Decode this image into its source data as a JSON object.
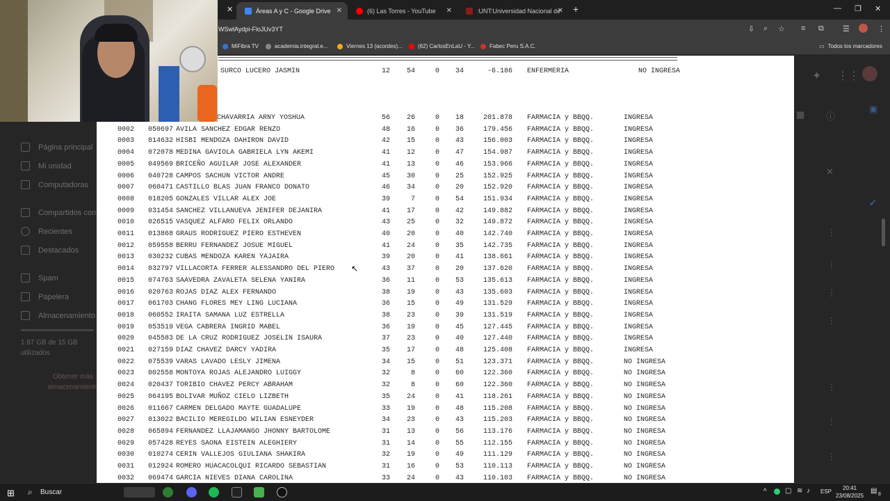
{
  "browser": {
    "tabs": [
      {
        "title": "Áreas A y C - Google Drive",
        "favicon_color": "#4285f4"
      },
      {
        "title": "(6) Las Torres - YouTube",
        "favicon_color": "#ff0000"
      },
      {
        "title": ":UNT:Universidad Nacional de",
        "favicon_color": "#8a1c1c"
      }
    ],
    "url": "WSwlAydpi-FloJUv3YT",
    "new_tab_icon": "plus-icon",
    "bookmarks": [
      {
        "label": "MiFibra TV",
        "icon_color": "#3a6fd8"
      },
      {
        "label": "academia.integral.e...",
        "icon_color": "#888888"
      },
      {
        "label": "Viernes 13 (acordes)...",
        "icon_color": "#f5a623"
      },
      {
        "label": "(62) CarlosEnLaU - Y...",
        "icon_color": "#ff0000"
      },
      {
        "label": "Fabec Peru S.A.C.",
        "icon_color": "#c0392b"
      }
    ],
    "all_bookmarks": "Todos los marcadores"
  },
  "drive_background": {
    "sidebar": [
      "Página principal",
      "Mi unidad",
      "Computadoras",
      "Compartidos conmigo",
      "Recientes",
      "Destacados",
      "Spam",
      "Papelera",
      "Almacenamiento"
    ],
    "storage_text": "1.87 GB de 15 GB utilizados",
    "get_more_storage": "Obtener más almacenamiento"
  },
  "document": {
    "top_row": {
      "name": "SURCO LUCERO JASMIN",
      "a": "12",
      "b": "54",
      "o": "0",
      "d": "34",
      "score": "-6.186",
      "career": "ENFERMERIA",
      "status": "NO INGRESA"
    },
    "rows": [
      {
        "n": "",
        "code": "",
        "name": "CHAVARRIA ARNY YOSHUA",
        "a": "56",
        "b": "26",
        "o": "0",
        "d": "18",
        "score": "201.878",
        "career": "FARMACIA y BBQQ.",
        "status": "INGRESA"
      },
      {
        "n": "0002",
        "code": "050697",
        "name": "AVILA SANCHEZ EDGAR RENZO",
        "a": "48",
        "b": "16",
        "o": "0",
        "d": "36",
        "score": "179.456",
        "career": "FARMACIA y BBQQ.",
        "status": "INGRESA"
      },
      {
        "n": "0003",
        "code": "014632",
        "name": "HISBI MENDOZA DAHIRON DAVID",
        "a": "42",
        "b": "15",
        "o": "0",
        "d": "43",
        "score": "156.003",
        "career": "FARMACIA y BBQQ.",
        "status": "INGRESA"
      },
      {
        "n": "0004",
        "code": "072078",
        "name": "MEDINA GAVIOLA GABRIELA LYN AKEMI",
        "a": "41",
        "b": "12",
        "o": "0",
        "d": "47",
        "score": "154.987",
        "career": "FARMACIA y BBQQ.",
        "status": "INGRESA"
      },
      {
        "n": "0005",
        "code": "049569",
        "name": "BRICEÑO AGUILAR JOSE ALEXANDER",
        "a": "41",
        "b": "13",
        "o": "0",
        "d": "46",
        "score": "153.966",
        "career": "FARMACIA y BBQQ.",
        "status": "INGRESA"
      },
      {
        "n": "0006",
        "code": "040728",
        "name": "CAMPOS SACHUN VICTOR ANDRE",
        "a": "45",
        "b": "30",
        "o": "0",
        "d": "25",
        "score": "152.925",
        "career": "FARMACIA y BBQQ.",
        "status": "INGRESA"
      },
      {
        "n": "0007",
        "code": "060471",
        "name": "CASTILLO BLAS JUAN FRANCO DONATO",
        "a": "46",
        "b": "34",
        "o": "0",
        "d": "20",
        "score": "152.920",
        "career": "FARMACIA y BBQQ.",
        "status": "INGRESA"
      },
      {
        "n": "0008",
        "code": "018205",
        "name": "GONZALES VILLAR ALEX JOE",
        "a": "39",
        "b": "7",
        "o": "0",
        "d": "54",
        "score": "151.934",
        "career": "FARMACIA y BBQQ.",
        "status": "INGRESA"
      },
      {
        "n": "0009",
        "code": "031454",
        "name": "SANCHEZ VILLANUEVA JENIFER DEJANIRA",
        "a": "41",
        "b": "17",
        "o": "0",
        "d": "42",
        "score": "149.882",
        "career": "FARMACIA y BBQQ.",
        "status": "INGRESA"
      },
      {
        "n": "0010",
        "code": "026515",
        "name": "VASQUEZ ALFARO FELIX ORLANDO",
        "a": "43",
        "b": "25",
        "o": "0",
        "d": "32",
        "score": "149.872",
        "career": "FARMACIA y BBQQ.",
        "status": "INGRESA"
      },
      {
        "n": "0011",
        "code": "013868",
        "name": "GRAUS RODRIGUEZ PIERO ESTHEVEN",
        "a": "40",
        "b": "20",
        "o": "0",
        "d": "40",
        "score": "142.740",
        "career": "FARMACIA y BBQQ.",
        "status": "INGRESA"
      },
      {
        "n": "0012",
        "code": "059558",
        "name": "BERRU FERNANDEZ JOSUE MIGUEL",
        "a": "41",
        "b": "24",
        "o": "0",
        "d": "35",
        "score": "142.735",
        "career": "FARMACIA y BBQQ.",
        "status": "INGRESA"
      },
      {
        "n": "0013",
        "code": "030232",
        "name": "CUBAS MENDOZA KAREN YAJAIRA",
        "a": "39",
        "b": "20",
        "o": "0",
        "d": "41",
        "score": "138.661",
        "career": "FARMACIA y BBQQ.",
        "status": "INGRESA"
      },
      {
        "n": "0014",
        "code": "032797",
        "name": "VILLACORTA FERRER ALESSANDRO DEL PIERO",
        "a": "43",
        "b": "37",
        "o": "0",
        "d": "20",
        "score": "137.620",
        "career": "FARMACIA y BBQQ.",
        "status": "INGRESA"
      },
      {
        "n": "0015",
        "code": "074763",
        "name": "SAAVEDRA ZAVALETA SELENA YANIRA",
        "a": "36",
        "b": "11",
        "o": "0",
        "d": "53",
        "score": "135.613",
        "career": "FARMACIA y BBQQ.",
        "status": "INGRESA"
      },
      {
        "n": "0016",
        "code": "020763",
        "name": "ROJAS DIAZ ALEX FERNANDO",
        "a": "38",
        "b": "19",
        "o": "0",
        "d": "43",
        "score": "135.603",
        "career": "FARMACIA y BBQQ.",
        "status": "INGRESA"
      },
      {
        "n": "0017",
        "code": "061703",
        "name": "CHANG FLORES MEY LING LUCIANA",
        "a": "36",
        "b": "15",
        "o": "0",
        "d": "49",
        "score": "131.529",
        "career": "FARMACIA y BBQQ.",
        "status": "INGRESA"
      },
      {
        "n": "0018",
        "code": "060552",
        "name": "IRAITA SAMANA LUZ ESTRELLA",
        "a": "38",
        "b": "23",
        "o": "0",
        "d": "39",
        "score": "131.519",
        "career": "FARMACIA y BBQQ.",
        "status": "INGRESA"
      },
      {
        "n": "0019",
        "code": "053519",
        "name": "VEGA CABRERA INGRID MABEL",
        "a": "36",
        "b": "19",
        "o": "0",
        "d": "45",
        "score": "127.445",
        "career": "FARMACIA y BBQQ.",
        "status": "INGRESA"
      },
      {
        "n": "0020",
        "code": "045583",
        "name": "DE LA CRUZ RODRIGUEZ JOSELIN ISAURA",
        "a": "37",
        "b": "23",
        "o": "0",
        "d": "40",
        "score": "127.440",
        "career": "FARMACIA y BBQQ.",
        "status": "INGRESA"
      },
      {
        "n": "0021",
        "code": "027159",
        "name": "DIAZ CHAVEZ DARCY YADIRA",
        "a": "35",
        "b": "17",
        "o": "0",
        "d": "48",
        "score": "125.408",
        "career": "FARMACIA y BBQQ.",
        "status": "INGRESA"
      },
      {
        "n": "0022",
        "code": "075539",
        "name": "VARAS LAVADO LESLY JIMENA",
        "a": "34",
        "b": "15",
        "o": "0",
        "d": "51",
        "score": "123.371",
        "career": "FARMACIA y BBQQ.",
        "status": "NO INGRESA"
      },
      {
        "n": "0023",
        "code": "002558",
        "name": "MONTOYA ROJAS ALEJANDRO LUIGGY",
        "a": "32",
        "b": "8",
        "o": "0",
        "d": "60",
        "score": "122.360",
        "career": "FARMACIA y BBQQ.",
        "status": "NO INGRESA"
      },
      {
        "n": "0024",
        "code": "020437",
        "name": "TORIBIO CHAVEZ PERCY ABRAHAM",
        "a": "32",
        "b": "8",
        "o": "0",
        "d": "60",
        "score": "122.360",
        "career": "FARMACIA y BBQQ.",
        "status": "NO INGRESA"
      },
      {
        "n": "0025",
        "code": "064195",
        "name": "BOLIVAR MUÑOZ CIELO LIZBETH",
        "a": "35",
        "b": "24",
        "o": "0",
        "d": "41",
        "score": "118.261",
        "career": "FARMACIA y BBQQ.",
        "status": "NO INGRESA"
      },
      {
        "n": "0026",
        "code": "011667",
        "name": "CARMEN DELGADO MAYTE GUADALUPE",
        "a": "33",
        "b": "19",
        "o": "0",
        "d": "48",
        "score": "115.208",
        "career": "FARMACIA y BBQQ.",
        "status": "NO INGRESA"
      },
      {
        "n": "0027",
        "code": "013022",
        "name": "BACILIO MEREGILDO WILIAN ESNEYDER",
        "a": "34",
        "b": "23",
        "o": "0",
        "d": "43",
        "score": "115.203",
        "career": "FARMACIA y BBQQ.",
        "status": "NO INGRESA"
      },
      {
        "n": "0028",
        "code": "065894",
        "name": "FERNANDEZ LLAJAMANGO JHONNY BARTOLOME",
        "a": "31",
        "b": "13",
        "o": "0",
        "d": "56",
        "score": "113.176",
        "career": "FARMACIA y BBQQ.",
        "status": "NO INGRESA"
      },
      {
        "n": "0029",
        "code": "057428",
        "name": "REYES SAONA EISTEIN ALEGHIERY",
        "a": "31",
        "b": "14",
        "o": "0",
        "d": "55",
        "score": "112.155",
        "career": "FARMACIA y BBQQ.",
        "status": "NO INGRESA"
      },
      {
        "n": "0030",
        "code": "010274",
        "name": "CERIN VALLEJOS GIULIANA SHAKIRA",
        "a": "32",
        "b": "19",
        "o": "0",
        "d": "49",
        "score": "111.129",
        "career": "FARMACIA y BBQQ.",
        "status": "NO INGRESA"
      },
      {
        "n": "0031",
        "code": "012924",
        "name": "ROMERO HUACACOLQUI RICARDO SEBASTIAN",
        "a": "31",
        "b": "16",
        "o": "0",
        "d": "53",
        "score": "110.113",
        "career": "FARMACIA y BBQQ.",
        "status": "NO INGRESA"
      },
      {
        "n": "0032",
        "code": "069474",
        "name": "GARCIA NIEVES DIANA CAROLINA",
        "a": "33",
        "b": "24",
        "o": "0",
        "d": "43",
        "score": "110.103",
        "career": "FARMACIA y BBQQ.",
        "status": "NO INGRESA"
      }
    ]
  },
  "taskbar": {
    "search_label": "Buscar",
    "language": "ESP",
    "time": "20:41",
    "date": "23/08/2025",
    "notification_count": "8"
  }
}
